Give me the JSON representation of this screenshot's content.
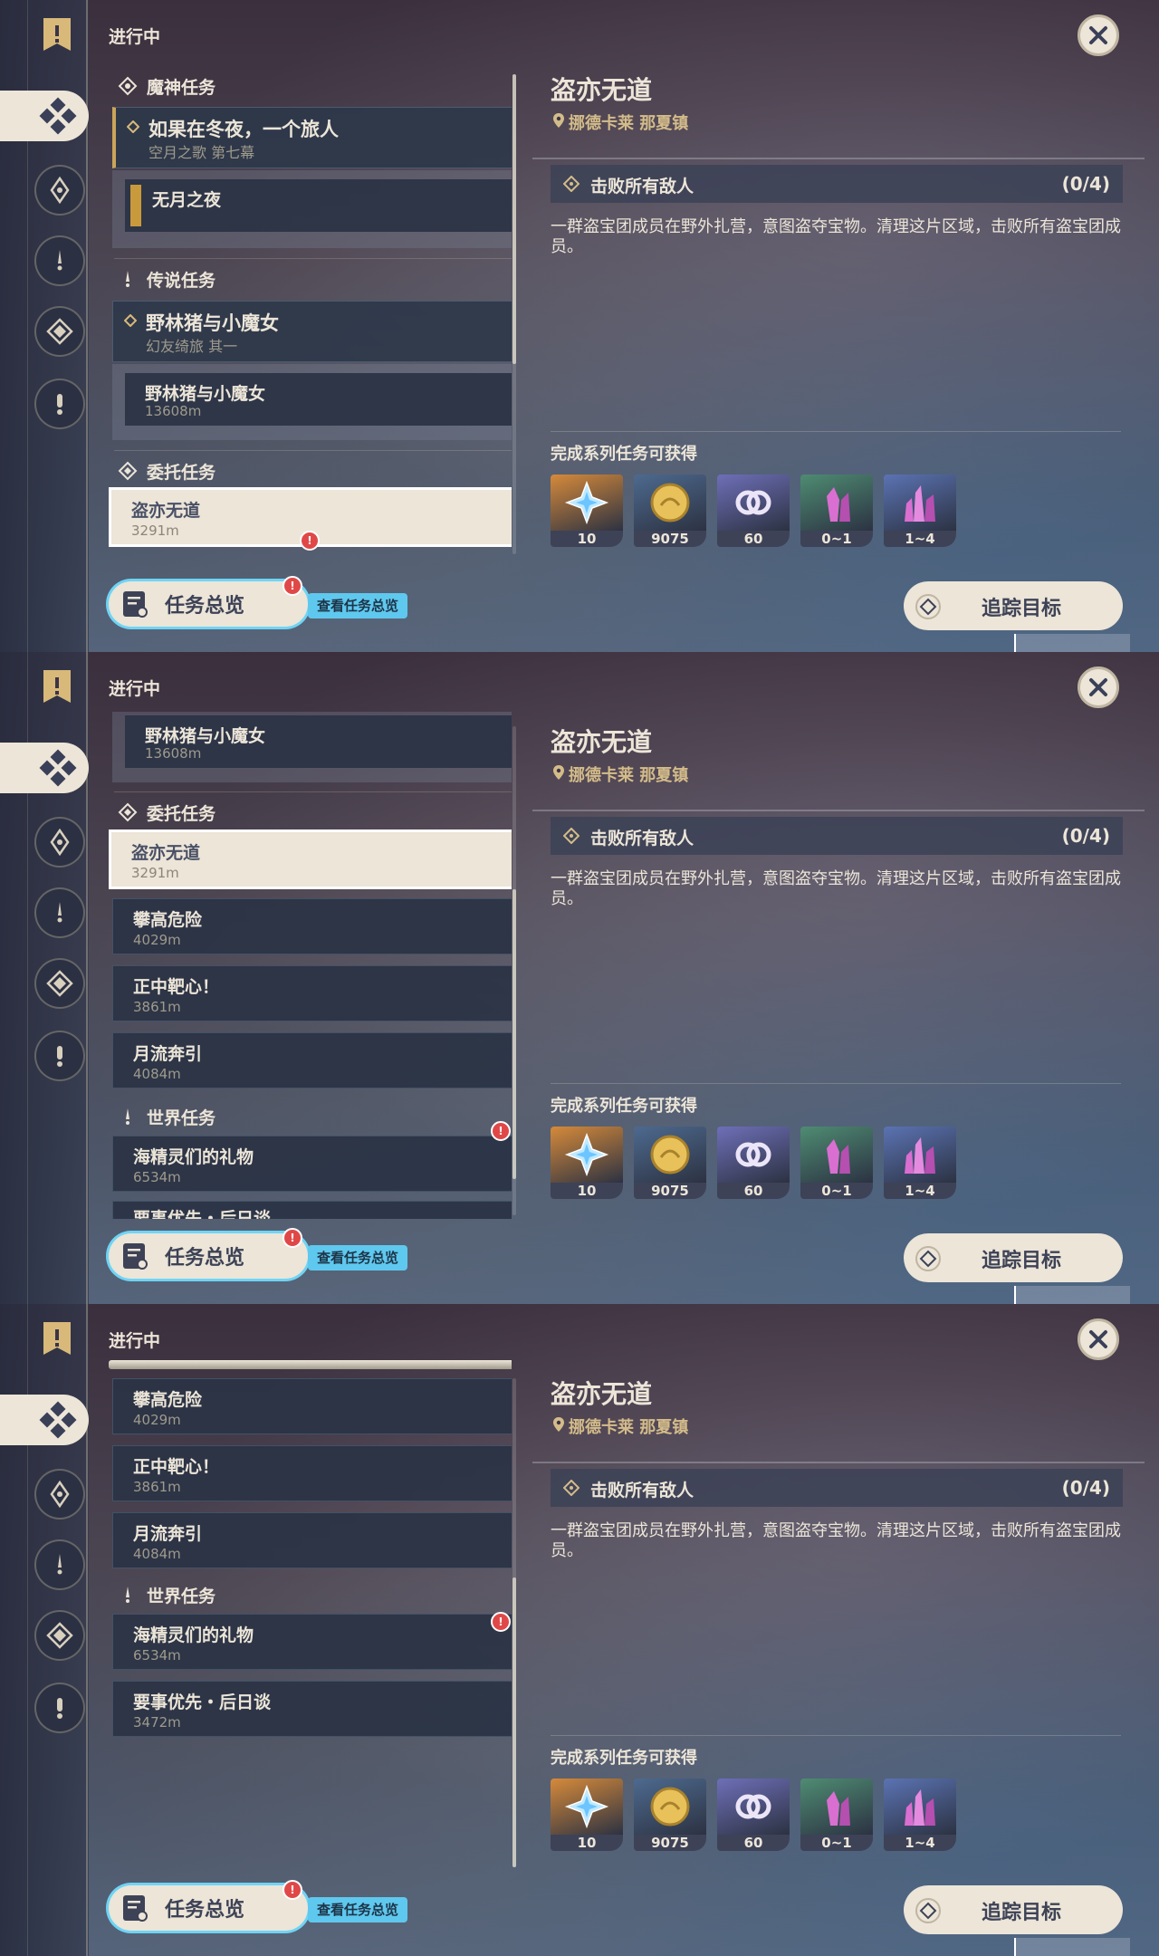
{
  "status": "进行中",
  "rail_icons": [
    "banner-icon",
    "commission-icon",
    "archon-icon",
    "legend-icon",
    "world-icon",
    "exclamation-icon"
  ],
  "close_icon": "close-icon",
  "list": {
    "archon_category": "魔神任务",
    "archon_quest": {
      "title": "如果在冬夜，一个旅人",
      "subtitle": "空月之歌 第七幕"
    },
    "archon_sub": "无月之夜",
    "legend_category": "传说任务",
    "legend_quest": {
      "title": "野林猪与小魔女",
      "subtitle": "幻友绮旅 其一"
    },
    "legend_sub": {
      "title": "野林猪与小魔女",
      "distance": "13608m"
    },
    "commission_category": "委托任务",
    "commissions": [
      {
        "title": "盗亦无道",
        "distance": "3291m"
      },
      {
        "title": "攀高危险",
        "distance": "4029m"
      },
      {
        "title": "正中靶心！",
        "distance": "3861m"
      },
      {
        "title": "月流奔引",
        "distance": "4084m"
      }
    ],
    "world_category": "世界任务",
    "world_quests": [
      {
        "title": "海精灵们的礼物",
        "distance": "6534m"
      },
      {
        "title": "要事优先・后日谈",
        "distance": "3472m"
      }
    ],
    "partial_title": "要事优先・后日谈"
  },
  "bottom": {
    "overview_label": "任务总览",
    "overview_tip": "查看任务总览",
    "badge": "!",
    "track_label": "追踪目标"
  },
  "detail": {
    "title": "盗亦无道",
    "location": "挪德卡莱 那夏镇",
    "objective": "击败所有敌人",
    "objective_count": "(0/4)",
    "description": "一群盗宝团成员在野外扎营，意图盗夺宝物。清理这片区域，击败所有盗宝团成员。",
    "rewards_title": "完成系列任务可获得",
    "rewards": [
      {
        "icon": "primogem-icon",
        "qty": "10",
        "bg": "#d68a3a"
      },
      {
        "icon": "mora-icon",
        "qty": "9075",
        "bg": "#4d6a8f"
      },
      {
        "icon": "companionship-icon",
        "qty": "60",
        "bg": "#6e6fb8"
      },
      {
        "icon": "crystal-icon",
        "qty": "0~1",
        "bg": "#4e8c72"
      },
      {
        "icon": "crystal-cluster-icon",
        "qty": "1~4",
        "bg": "#5b73b3"
      }
    ]
  },
  "colors": {
    "accent": "#ece5d8",
    "gold": "#caa55a",
    "tip": "#5fc8ee",
    "alert": "#e04848"
  }
}
